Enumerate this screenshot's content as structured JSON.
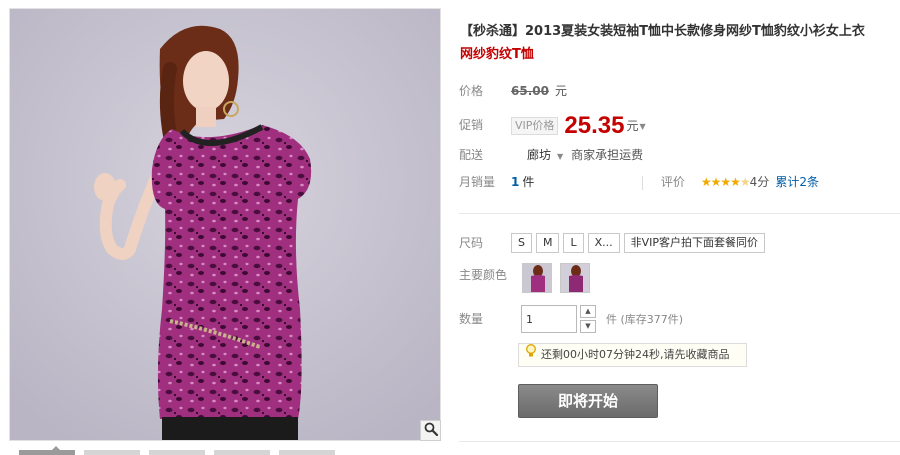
{
  "product": {
    "title_main": "【秒杀通】2013夏装女装短袖T恤中长款修身网纱T恤豹纹小衫女上衣",
    "title_sub": "网纱豹纹T恤"
  },
  "price": {
    "label": "价格",
    "original": "65.00",
    "unit": "元"
  },
  "promo": {
    "label": "促销",
    "tag": "VIP价格",
    "price": "25.35",
    "unit": "元"
  },
  "shipping": {
    "label": "配送",
    "location": "廊坊",
    "note": "商家承担运费"
  },
  "sales": {
    "label": "月销量",
    "count": "1",
    "unit": "件",
    "review_label": "评价",
    "stars": "★★★★",
    "half_star": "★",
    "score": "4分",
    "review_count": "累计2条"
  },
  "size": {
    "label": "尺码",
    "options": [
      "S",
      "M",
      "L",
      "X..."
    ],
    "note_btn": "非VIP客户拍下面套餐同价"
  },
  "color": {
    "label": "主要颜色"
  },
  "quantity": {
    "label": "数量",
    "value": "1",
    "stock": "件 (库存377件)"
  },
  "countdown": {
    "text": "还剩00小时07分钟24秒,请先收藏商品"
  },
  "action": {
    "start_label": "即将开始"
  },
  "icons": {
    "zoom": "magnifier-icon",
    "bulb": "lightbulb-icon",
    "caret": "caret-down-icon"
  },
  "colors": {
    "price_red": "#c40000",
    "link_blue": "#005ea7",
    "star_gold": "#f2a900",
    "button_gray": "#7a7a7a"
  }
}
